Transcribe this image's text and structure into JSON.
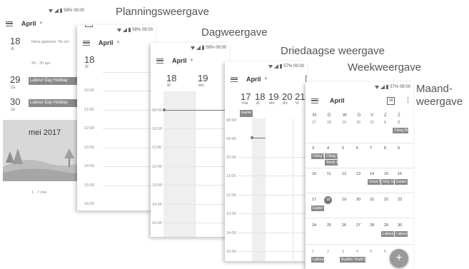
{
  "labels": {
    "planning": "Planningsweergave",
    "day": "Dagweergave",
    "three_day": "Driedaagse weergave",
    "week": "Weekweergave",
    "month_l1": "Maand-",
    "month_l2": "weergave"
  },
  "status": {
    "battery_58": "58% 09:00",
    "battery_57": "57% 09:00"
  },
  "appbar": {
    "month": "April"
  },
  "calendar_icon_text": "18",
  "more_icon": "⋮",
  "caret": "▼",
  "planning": {
    "day1_num": "18",
    "day1_name": "di",
    "nothing_planned": "Niets gepland. Tik om",
    "range": "24 - 30 apr.",
    "day2_num": "29",
    "day2_name": "za",
    "day2_event": "Labour Day Holiday",
    "day3_num": "30",
    "day3_name": "zo",
    "day3_event": "Labour Day Holiday",
    "banner": "mei 2017",
    "week_range": "1 - 7 mei"
  },
  "dayview": {
    "day_num": "18",
    "day_name": "di",
    "hours": [
      "10:00",
      "11:00",
      "12:00",
      "13:00",
      "14:00",
      "15:00",
      "16:00"
    ]
  },
  "threeday": {
    "d1_num": "18",
    "d1_name": "di",
    "d2_num": "19",
    "d2_name": "wo",
    "hours": [
      "09:00",
      "10:00",
      "11:00",
      "12:00",
      "13:00",
      "14:00",
      "15:00"
    ]
  },
  "weekview": {
    "days": [
      {
        "num": "17",
        "name": "ma"
      },
      {
        "num": "18",
        "name": "di"
      },
      {
        "num": "19",
        "name": "wo"
      },
      {
        "num": "20",
        "name": "do"
      },
      {
        "num": "21",
        "name": "vr"
      }
    ],
    "event": "Easter",
    "hours": [
      "08:00",
      "09:00",
      "10:00",
      "11:00",
      "12:00",
      "13:00",
      "14:00",
      "15:00"
    ]
  },
  "monthview": {
    "weekdays": [
      "M",
      "D",
      "W",
      "D",
      "V",
      "Z",
      "Z"
    ],
    "weeks": [
      [
        "27",
        "28",
        "29",
        "30",
        "31",
        "1",
        "2"
      ],
      [
        "3",
        "4",
        "5",
        "6",
        "7",
        "8",
        "9"
      ],
      [
        "10",
        "11",
        "12",
        "13",
        "14",
        "15",
        "16"
      ],
      [
        "17",
        "18",
        "19",
        "20",
        "21",
        "22",
        "23"
      ],
      [
        "24",
        "25",
        "26",
        "27",
        "28",
        "29",
        "30"
      ],
      [
        "1",
        "2",
        "3",
        "4",
        "5",
        "6",
        ""
      ]
    ],
    "events": {
      "e1": "Ching Ming",
      "e2": "Ching Mi",
      "e3": "Ching Mi",
      "e4": "Tomb Sw",
      "e5": "Good Fri",
      "e6": "Holy Sat",
      "e7": "Easter S",
      "e8": "Easter M",
      "e9": "Labour",
      "e10": "Labour Day",
      "e11": "Labour",
      "e12": "Buddha",
      "e13": "Youth D"
    },
    "fab": "+"
  }
}
